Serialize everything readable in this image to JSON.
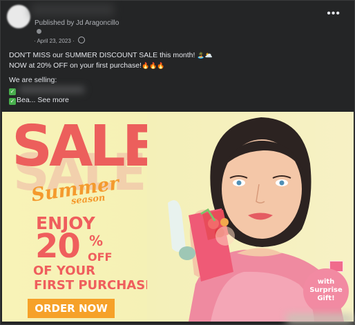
{
  "post": {
    "published_by": "Published by Jd Aragoncillo",
    "date": "April 23, 2023",
    "date_separator": "·",
    "more_icon": "more-horizontal-icon",
    "globe_icon": "globe-icon",
    "lines": {
      "headline": "DON'T MISS our SUMMER DISCOUNT SALE this month! ",
      "headline_emoji": "🏝️🌥️",
      "offer": "NOW at 20% OFF on your first purchase!",
      "offer_emoji": "🔥🔥🔥",
      "selling": "We are selling:",
      "item2_prefix": "Bea...",
      "see_more": " See more"
    }
  },
  "banner": {
    "sale": "SALE",
    "summer": "Summer",
    "season": "season",
    "enjoy": "ENJOY",
    "percent": "20",
    "percent_sign": "%",
    "off": "OFF",
    "of_your": "OF YOUR",
    "first_purchase": "FIRST PURCHASE!",
    "order_button": "ORDER NOW",
    "badge": "with Surprise Gift!"
  }
}
